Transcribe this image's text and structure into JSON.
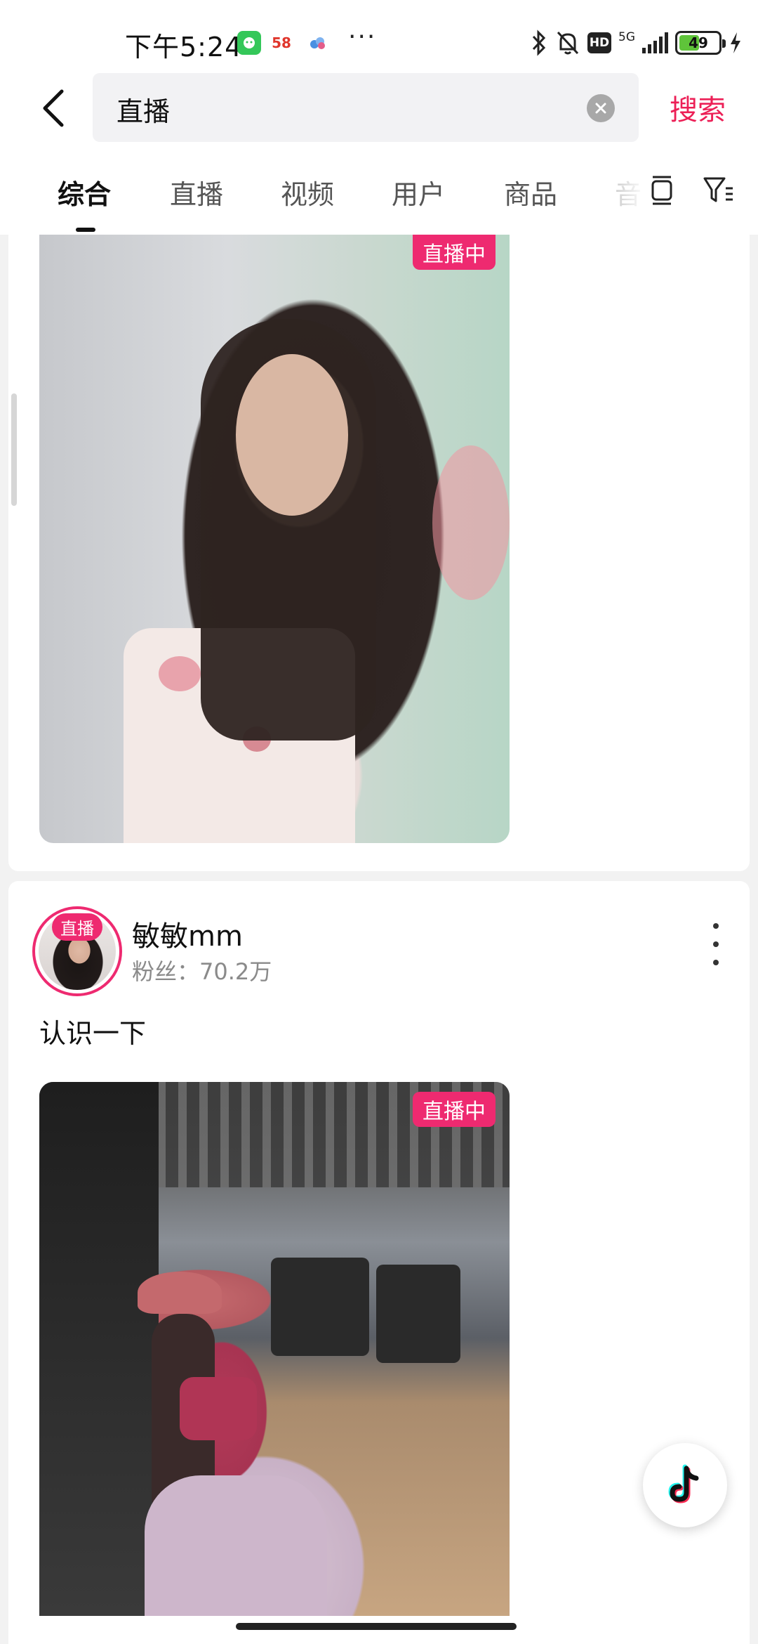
{
  "status_bar": {
    "time": "下午5:24",
    "app_icon_2_label": "58",
    "more": "···",
    "hd_label": "HD",
    "network_label": "5G",
    "battery_level": "49"
  },
  "search": {
    "query": "直播",
    "submit_label": "搜索"
  },
  "tabs": [
    {
      "label": "综合",
      "active": true
    },
    {
      "label": "直播",
      "active": false
    },
    {
      "label": "视频",
      "active": false
    },
    {
      "label": "用户",
      "active": false
    },
    {
      "label": "商品",
      "active": false
    },
    {
      "label": "音",
      "active": false
    }
  ],
  "results": [
    {
      "live_badge": "直播中"
    },
    {
      "avatar_tag": "直播",
      "user_name": "敏敏mm",
      "followers": "粉丝：70.2万",
      "caption": "认识一下",
      "live_badge": "直播中"
    }
  ],
  "colors": {
    "accent": "#ec1f56",
    "live_pink": "#ee2a70"
  },
  "icons": {
    "back": "chevron-left-icon",
    "clear": "clear-circle-icon",
    "layout": "layout-toggle-icon",
    "filter": "filter-icon",
    "float": "douyin-logo-icon"
  }
}
